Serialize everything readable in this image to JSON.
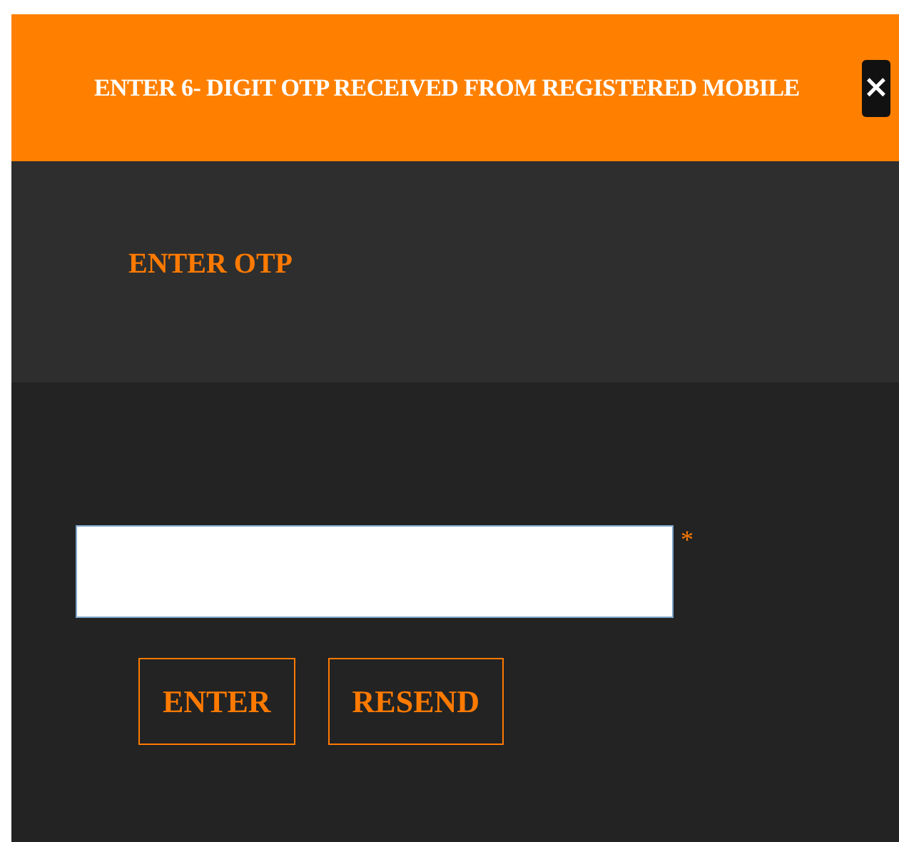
{
  "dialog": {
    "title": "ENTER 6- DIGIT OTP RECEIVED FROM REGISTERED MOBILE",
    "close": "×"
  },
  "section_label": "ENTER OTP",
  "otp_field": {
    "required_mark": "*"
  },
  "buttons": [
    {
      "label": "ENTER"
    },
    {
      "label": "RESEND"
    }
  ]
}
